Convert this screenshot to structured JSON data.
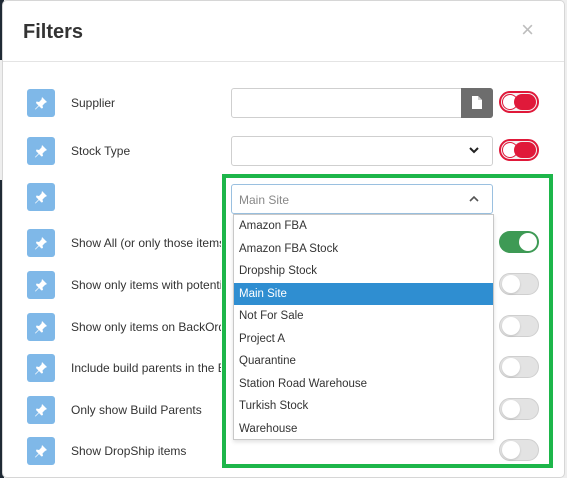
{
  "modal": {
    "title": "Filters",
    "close_symbol": "×"
  },
  "rows": [
    {
      "label": "Supplier",
      "control": "text-with-button",
      "toggle": "red"
    },
    {
      "label": "Stock Type",
      "control": "select",
      "toggle": "red"
    },
    {
      "label": "",
      "control": "open-select",
      "toggle": "hidden"
    },
    {
      "label": "Show All (or only those items",
      "toggle": "green"
    },
    {
      "label": "Show only items with potential",
      "toggle": "off"
    },
    {
      "label": "Show only items on BackOrder",
      "toggle": "off"
    },
    {
      "label": "Include build parents in the B",
      "toggle": "off"
    },
    {
      "label": "Only show Build Parents",
      "toggle": "off"
    },
    {
      "label": "Show DropShip items",
      "toggle": "off"
    }
  ],
  "location_select": {
    "value": "Main Site",
    "options": [
      "Amazon FBA",
      "Amazon FBA Stock",
      "Dropship Stock",
      "Main Site",
      "Not For Sale",
      "Project A",
      "Quarantine",
      "Station Road Warehouse",
      "Turkish Stock",
      "Warehouse"
    ],
    "selected_index": 3
  },
  "colors": {
    "pin_button": "#7fb8e8",
    "toggle_red": "#e0193a",
    "toggle_green": "#3e9a55",
    "selected_option": "#2f8ed1",
    "highlight_frame": "#1db64a"
  },
  "icons": {
    "pin": "pin-icon",
    "file": "file-icon",
    "chevron_down": "chevron-down-icon",
    "chevron_up": "chevron-up-icon",
    "close": "close-icon"
  }
}
